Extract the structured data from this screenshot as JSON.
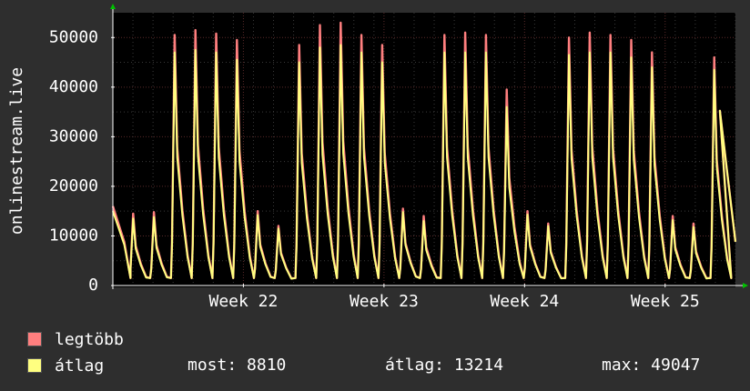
{
  "chart_data": {
    "type": "area",
    "ylabel": "onlinestream.live",
    "ylim": [
      0,
      55000
    ],
    "yticks": [
      0,
      10000,
      20000,
      30000,
      40000,
      50000
    ],
    "ytick_labels": [
      "0",
      "10000",
      "20000",
      "30000",
      "40000",
      "50000"
    ],
    "xlim": [
      0,
      31
    ],
    "xticks": [
      {
        "x": 6.5,
        "label": "Week 22"
      },
      {
        "x": 13.5,
        "label": "Week 23"
      },
      {
        "x": 20.5,
        "label": "Week 24"
      },
      {
        "x": 27.5,
        "label": "Week 25"
      }
    ],
    "grid": true,
    "series": [
      {
        "name": "legtöbb",
        "color": "#ff7f7f",
        "start": 16000,
        "peaks": [
          14500,
          14800,
          50500,
          51500,
          50800,
          49500,
          15000,
          12000,
          48500,
          52500,
          53000,
          50500,
          48500,
          15500,
          14000,
          50500,
          51000,
          50500,
          39500,
          15000,
          12500,
          50000,
          51000,
          50500,
          49500,
          47000,
          14000,
          12500,
          46000
        ],
        "end": 8810
      },
      {
        "name": "átlag",
        "color": "#ffff80",
        "start": 15000,
        "peaks": [
          13500,
          13800,
          47000,
          47500,
          47000,
          45500,
          14200,
          11500,
          45000,
          48000,
          48500,
          47000,
          45000,
          14800,
          13000,
          47000,
          47000,
          47000,
          36000,
          14300,
          12000,
          46500,
          47000,
          47000,
          46000,
          44000,
          13200,
          11800,
          43500
        ],
        "end": 8810
      }
    ],
    "trough": 1500
  },
  "legend": [
    {
      "label": "legtöbb",
      "color": "#ff7f7f"
    },
    {
      "label": "átlag",
      "color": "#ffff80"
    }
  ],
  "stats": {
    "now": "most: 8810",
    "avg": "átlag: 13214",
    "max": "max: 49047"
  }
}
